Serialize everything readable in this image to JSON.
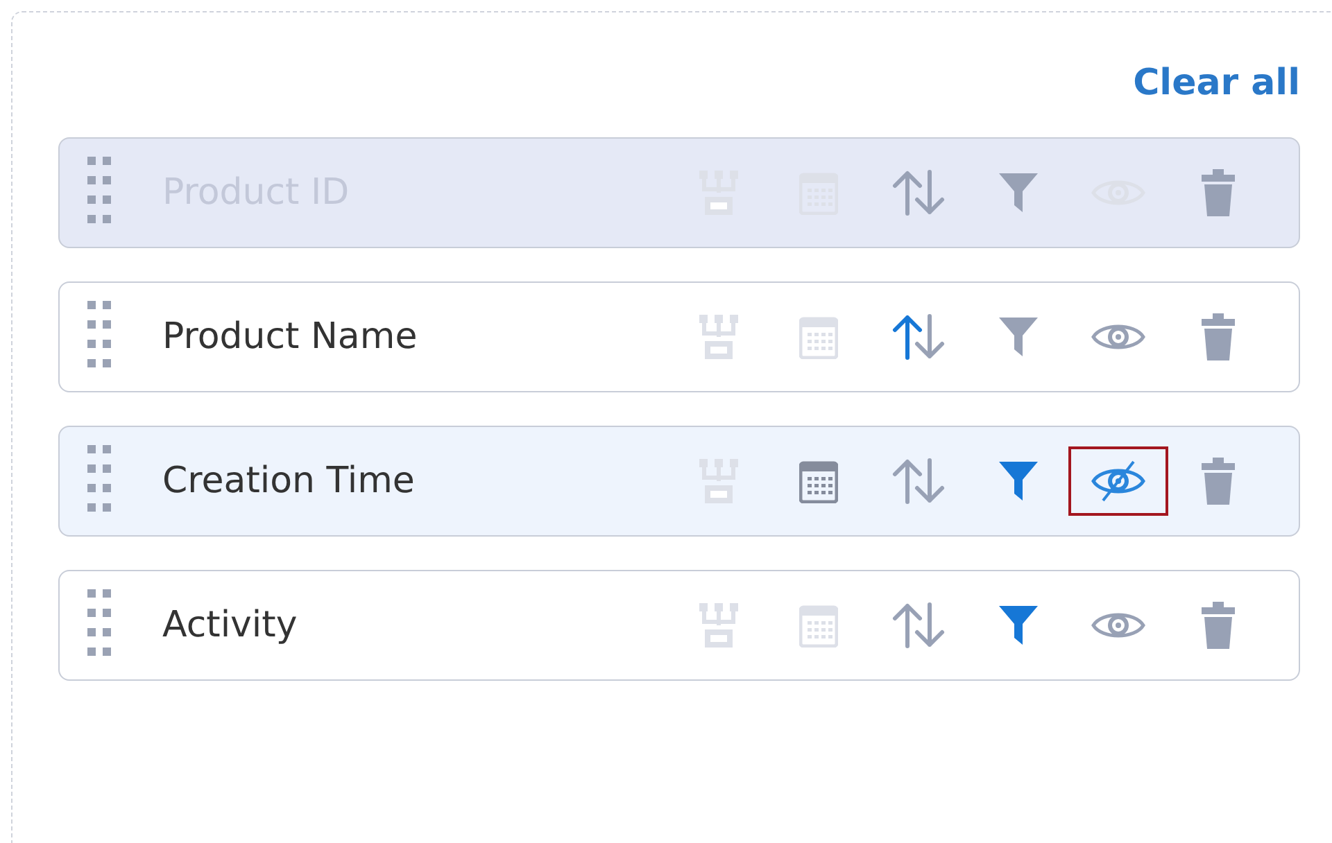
{
  "clear_all": "Clear all",
  "rows": [
    {
      "label": "Product ID",
      "disabled": true,
      "selected": false,
      "date_enabled": false,
      "sort_ascending": false,
      "filtered": false,
      "hidden": false,
      "eye_outlined": false
    },
    {
      "label": "Product Name",
      "disabled": false,
      "selected": false,
      "date_enabled": false,
      "sort_ascending": true,
      "filtered": false,
      "hidden": false,
      "eye_outlined": false
    },
    {
      "label": "Creation Time",
      "disabled": false,
      "selected": true,
      "date_enabled": true,
      "sort_ascending": false,
      "filtered": true,
      "hidden": true,
      "eye_outlined": true
    },
    {
      "label": "Activity",
      "disabled": false,
      "selected": false,
      "date_enabled": false,
      "sort_ascending": false,
      "filtered": true,
      "hidden": false,
      "eye_outlined": false
    }
  ]
}
